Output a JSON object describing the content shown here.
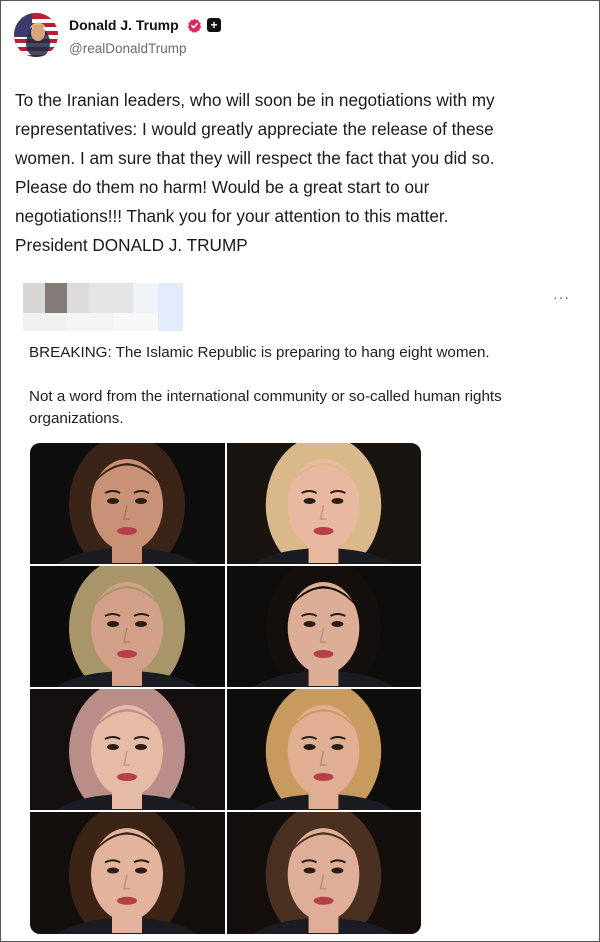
{
  "post": {
    "author_name": "Donald J. Trump",
    "author_handle": "@realDonaldTrump",
    "verified_icon": "verified-badge-icon",
    "text_lines": [
      "To the Iranian leaders, who will soon be in negotiations with my",
      "representatives: I would greatly appreciate the release of these",
      "women. I am sure that they will respect the fact that you did so.",
      "Please do them no harm! Would be a great start to our",
      "negotiations!!! Thank you for your attention to this matter.",
      "President DONALD J. TRUMP"
    ]
  },
  "embedded_post": {
    "more_label": "···",
    "text_1": "BREAKING: The Islamic Republic is preparing to hang eight women.",
    "text_2": "Not a word from the international community or so-called human rights organizations.",
    "photos": [
      {
        "bg": "#0e0e0e",
        "hair": "#3a2418",
        "skin": "#c99276"
      },
      {
        "bg": "#1a1410",
        "hair": "#d9b88a",
        "skin": "#e8b8a0"
      },
      {
        "bg": "#0c0c0c",
        "hair": "#a8956a",
        "skin": "#d2a088"
      },
      {
        "bg": "#0d0d0d",
        "hair": "#140e0c",
        "skin": "#dcae98"
      },
      {
        "bg": "#151010",
        "hair": "#b98d88",
        "skin": "#e6bba6"
      },
      {
        "bg": "#0f0d0b",
        "hair": "#c79a5f",
        "skin": "#e0ae92"
      },
      {
        "bg": "#120f0d",
        "hair": "#3b2416",
        "skin": "#e3b39d"
      },
      {
        "bg": "#140f0c",
        "hair": "#4a3020",
        "skin": "#dfae98"
      }
    ]
  },
  "colors": {
    "verified": "#e0245e",
    "handle": "#6b6b6b"
  }
}
